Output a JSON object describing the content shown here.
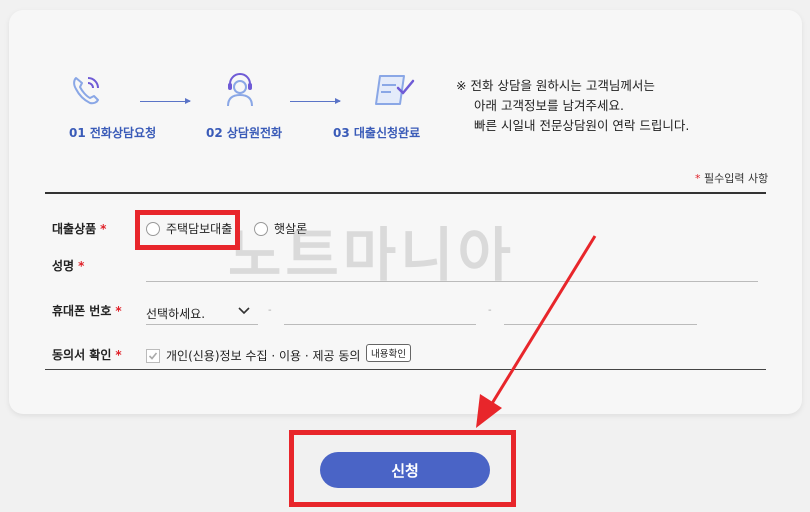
{
  "steps": [
    {
      "label": "01 전화상담요청",
      "icon": "phone-call-icon"
    },
    {
      "label": "02 상담원전화",
      "icon": "headset-agent-icon"
    },
    {
      "label": "03 대출신청완료",
      "icon": "document-check-icon"
    }
  ],
  "notice": {
    "mark": "※",
    "line1": "전화 상담을 원하시는 고객님께서는",
    "line2": "아래 고객정보를 남겨주세요.",
    "line3": "빠른 시일내 전문상담원이 연락 드립니다."
  },
  "required_note": {
    "star": "*",
    "text": "필수입력 사항"
  },
  "form": {
    "loan_product": {
      "label": "대출상품",
      "options": [
        "주택담보대출",
        "햇살론"
      ]
    },
    "name": {
      "label": "성명",
      "value": ""
    },
    "phone": {
      "label": "휴대폰 번호",
      "select_value": "선택하세요.",
      "separator": "-"
    },
    "consent": {
      "label": "동의서 확인",
      "text": "개인(신용)정보 수집 · 이용 · 제공 동의",
      "button": "내용확인",
      "checked": true
    },
    "required_star": "*"
  },
  "submit_label": "신청",
  "watermark": "노트마니아",
  "colors": {
    "accent": "#4a64c6",
    "required": "#e0222a",
    "highlight": "#e8262b"
  }
}
